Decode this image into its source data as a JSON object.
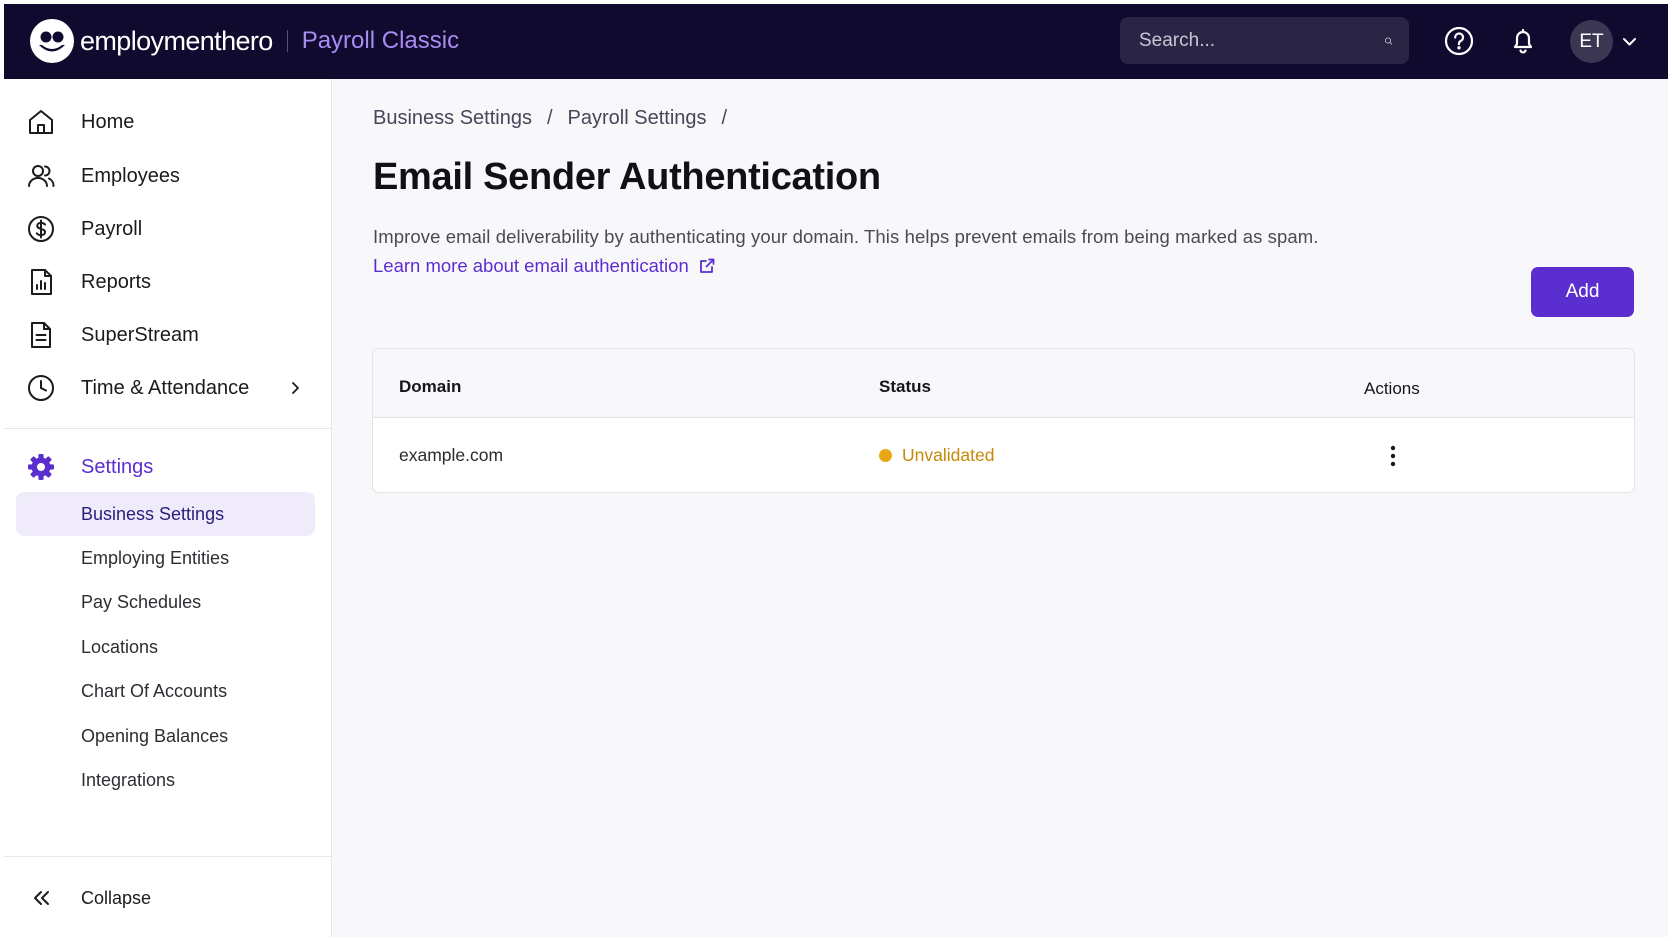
{
  "header": {
    "brand_name": "employmenthero",
    "product_name": "Payroll Classic",
    "search_placeholder": "Search...",
    "avatar_initials": "ET"
  },
  "colors": {
    "topbar": "#0f0a2e",
    "accent": "#5b2ed0",
    "status_unvalidated": "#e8a816"
  },
  "sidebar": {
    "items": [
      {
        "label": "Home",
        "icon": "home-icon"
      },
      {
        "label": "Employees",
        "icon": "users-icon"
      },
      {
        "label": "Payroll",
        "icon": "dollar-circle-icon"
      },
      {
        "label": "Reports",
        "icon": "report-chart-icon"
      },
      {
        "label": "SuperStream",
        "icon": "document-icon"
      },
      {
        "label": "Time & Attendance",
        "icon": "clock-icon"
      }
    ],
    "settings_label": "Settings",
    "settings_sub_items": [
      "Business Settings",
      "Employing Entities",
      "Pay Schedules",
      "Locations",
      "Chart Of Accounts",
      "Opening Balances",
      "Integrations"
    ],
    "active_sub_item": "Business Settings",
    "collapse_label": "Collapse"
  },
  "main": {
    "breadcrumbs": [
      "Business Settings",
      "Payroll Settings"
    ],
    "breadcrumb_separator": "/",
    "title": "Email Sender Authentication",
    "description": "Improve email deliverability by authenticating your domain. This helps prevent emails from being marked as spam.",
    "learn_more_link": "Learn more about email authentication",
    "add_button": "Add",
    "table": {
      "columns": [
        "Domain",
        "Status",
        "Actions"
      ],
      "rows": [
        {
          "domain": "example.com",
          "status": "Unvalidated"
        }
      ]
    }
  }
}
